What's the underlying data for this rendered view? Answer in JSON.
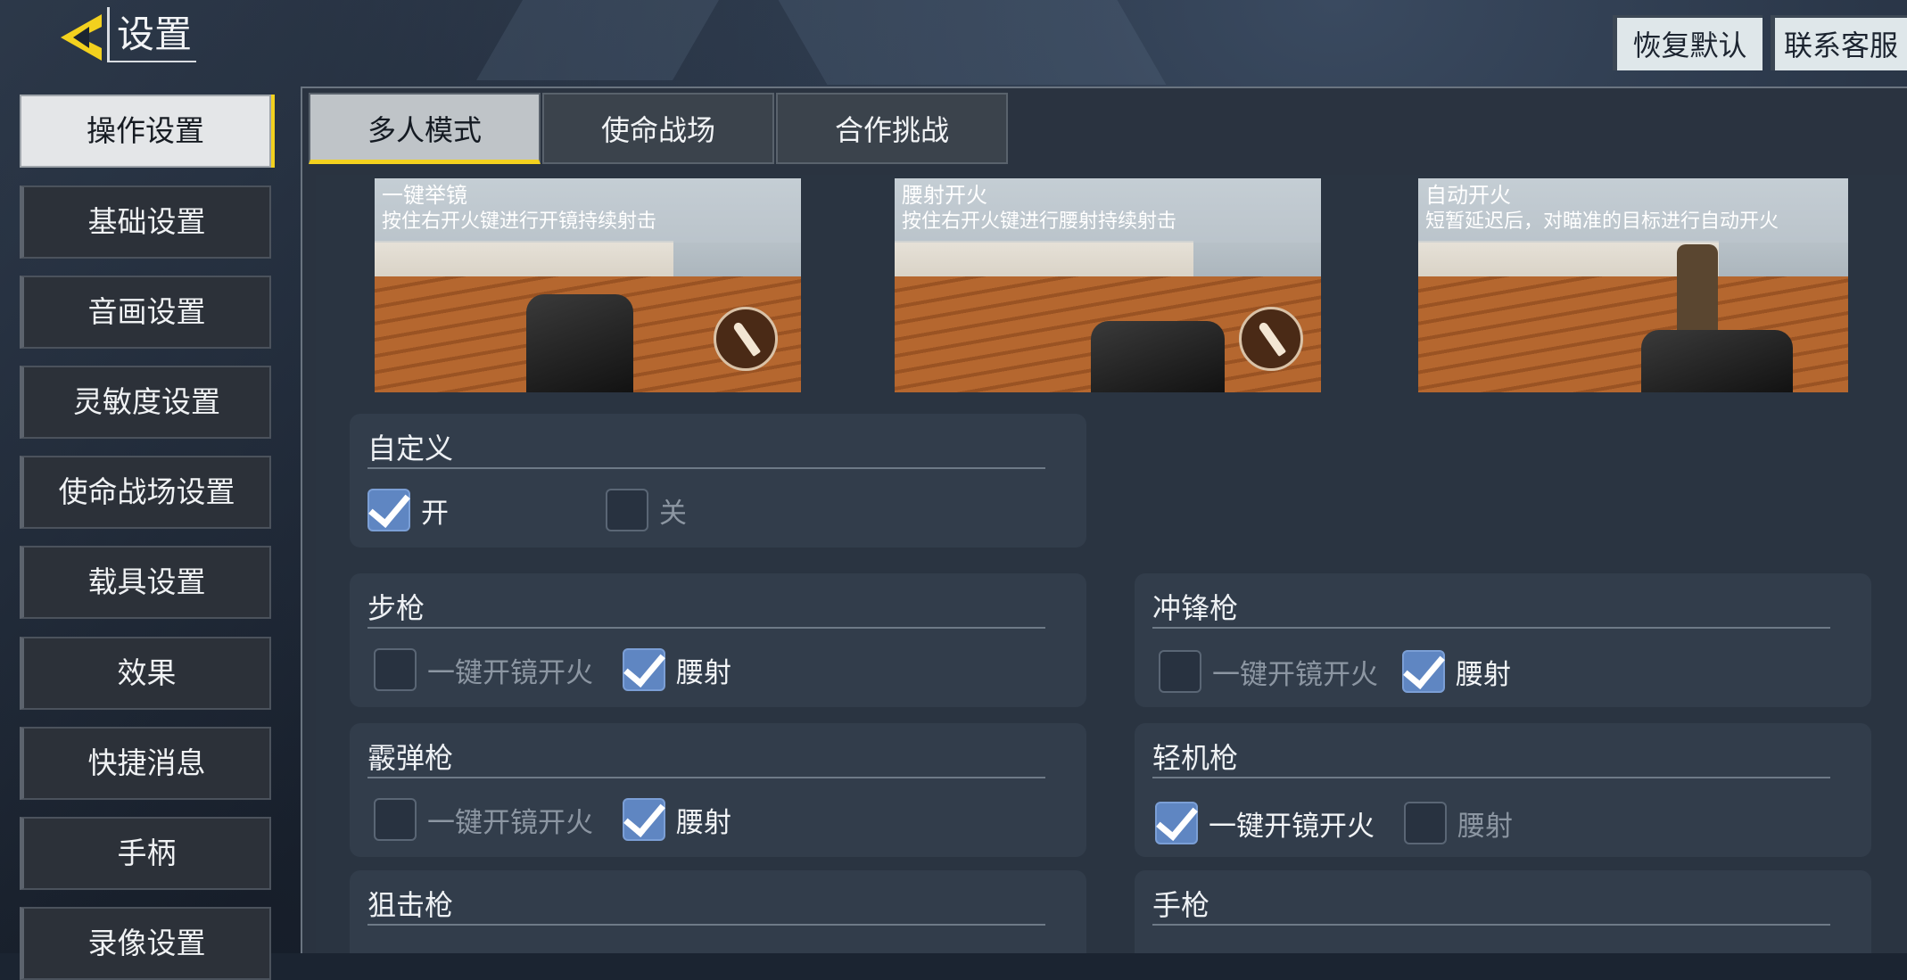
{
  "header": {
    "title": "设置",
    "restore_default": "恢复默认",
    "contact_support": "联系客服"
  },
  "sidebar": {
    "items": [
      {
        "label": "操作设置",
        "active": true
      },
      {
        "label": "基础设置"
      },
      {
        "label": "音画设置"
      },
      {
        "label": "灵敏度设置"
      },
      {
        "label": "使命战场设置"
      },
      {
        "label": "载具设置"
      },
      {
        "label": "效果"
      },
      {
        "label": "快捷消息"
      },
      {
        "label": "手柄"
      },
      {
        "label": "录像设置"
      }
    ]
  },
  "tabs": [
    {
      "label": "多人模式",
      "active": true
    },
    {
      "label": "使命战场"
    },
    {
      "label": "合作挑战"
    }
  ],
  "previews": [
    {
      "title": "一键举镜",
      "desc": "按住右开火键进行开镜持续射击"
    },
    {
      "title": "腰射开火",
      "desc": "按住右开火键进行腰射持续射击"
    },
    {
      "title": "自动开火",
      "desc": "短暂延迟后，对瞄准的目标进行自动开火"
    }
  ],
  "groups": {
    "custom": {
      "title": "自定义",
      "on": "开",
      "off": "关",
      "value": "开"
    },
    "rifle": {
      "title": "步枪",
      "opt1": "一键开镜开火",
      "opt2": "腰射",
      "selected": "腰射"
    },
    "smg": {
      "title": "冲锋枪",
      "opt1": "一键开镜开火",
      "opt2": "腰射",
      "selected": "腰射"
    },
    "shotgun": {
      "title": "霰弹枪",
      "opt1": "一键开镜开火",
      "opt2": "腰射",
      "selected": "腰射"
    },
    "lmg": {
      "title": "轻机枪",
      "opt1": "一键开镜开火",
      "opt2": "腰射",
      "selected": "一键开镜开火"
    },
    "sniper": {
      "title": "狙击枪"
    },
    "pistol": {
      "title": "手枪"
    }
  },
  "colors": {
    "accent": "#f3d11e",
    "checkbox_checked": "#5f86c2"
  }
}
